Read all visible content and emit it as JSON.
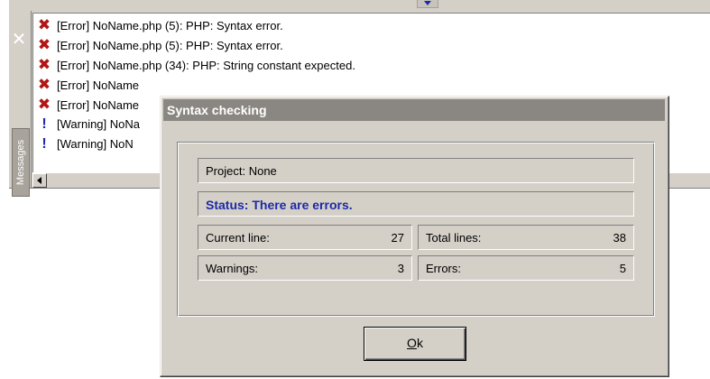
{
  "messages_panel": {
    "tab_label": "Messages",
    "items": [
      {
        "type": "error",
        "text": "[Error] NoName.php (5): PHP: Syntax error."
      },
      {
        "type": "error",
        "text": "[Error] NoName.php (5): PHP: Syntax error."
      },
      {
        "type": "error",
        "text": "[Error] NoName.php (34): PHP: String constant expected."
      },
      {
        "type": "error",
        "text": "[Error] NoName"
      },
      {
        "type": "error",
        "text": "[Error] NoName"
      },
      {
        "type": "warning",
        "text": "[Warning] NoNa"
      },
      {
        "type": "warning",
        "text": "[Warning] NoN"
      }
    ]
  },
  "dialog": {
    "title": "Syntax checking",
    "project_label": "Project:",
    "project_value": "None",
    "status_text": "Status: There are errors.",
    "current_line_label": "Current line:",
    "current_line_value": "27",
    "total_lines_label": "Total lines:",
    "total_lines_value": "38",
    "warnings_label": "Warnings:",
    "warnings_value": "3",
    "errors_label": "Errors:",
    "errors_value": "5",
    "ok_mnemonic": "O",
    "ok_rest": "k"
  },
  "icons": {
    "error": "red-x-icon",
    "warning": "blue-exclamation-icon"
  },
  "colors": {
    "error": "#b21515",
    "warning": "#1c2aa8",
    "status_text": "#1c2aa8"
  }
}
